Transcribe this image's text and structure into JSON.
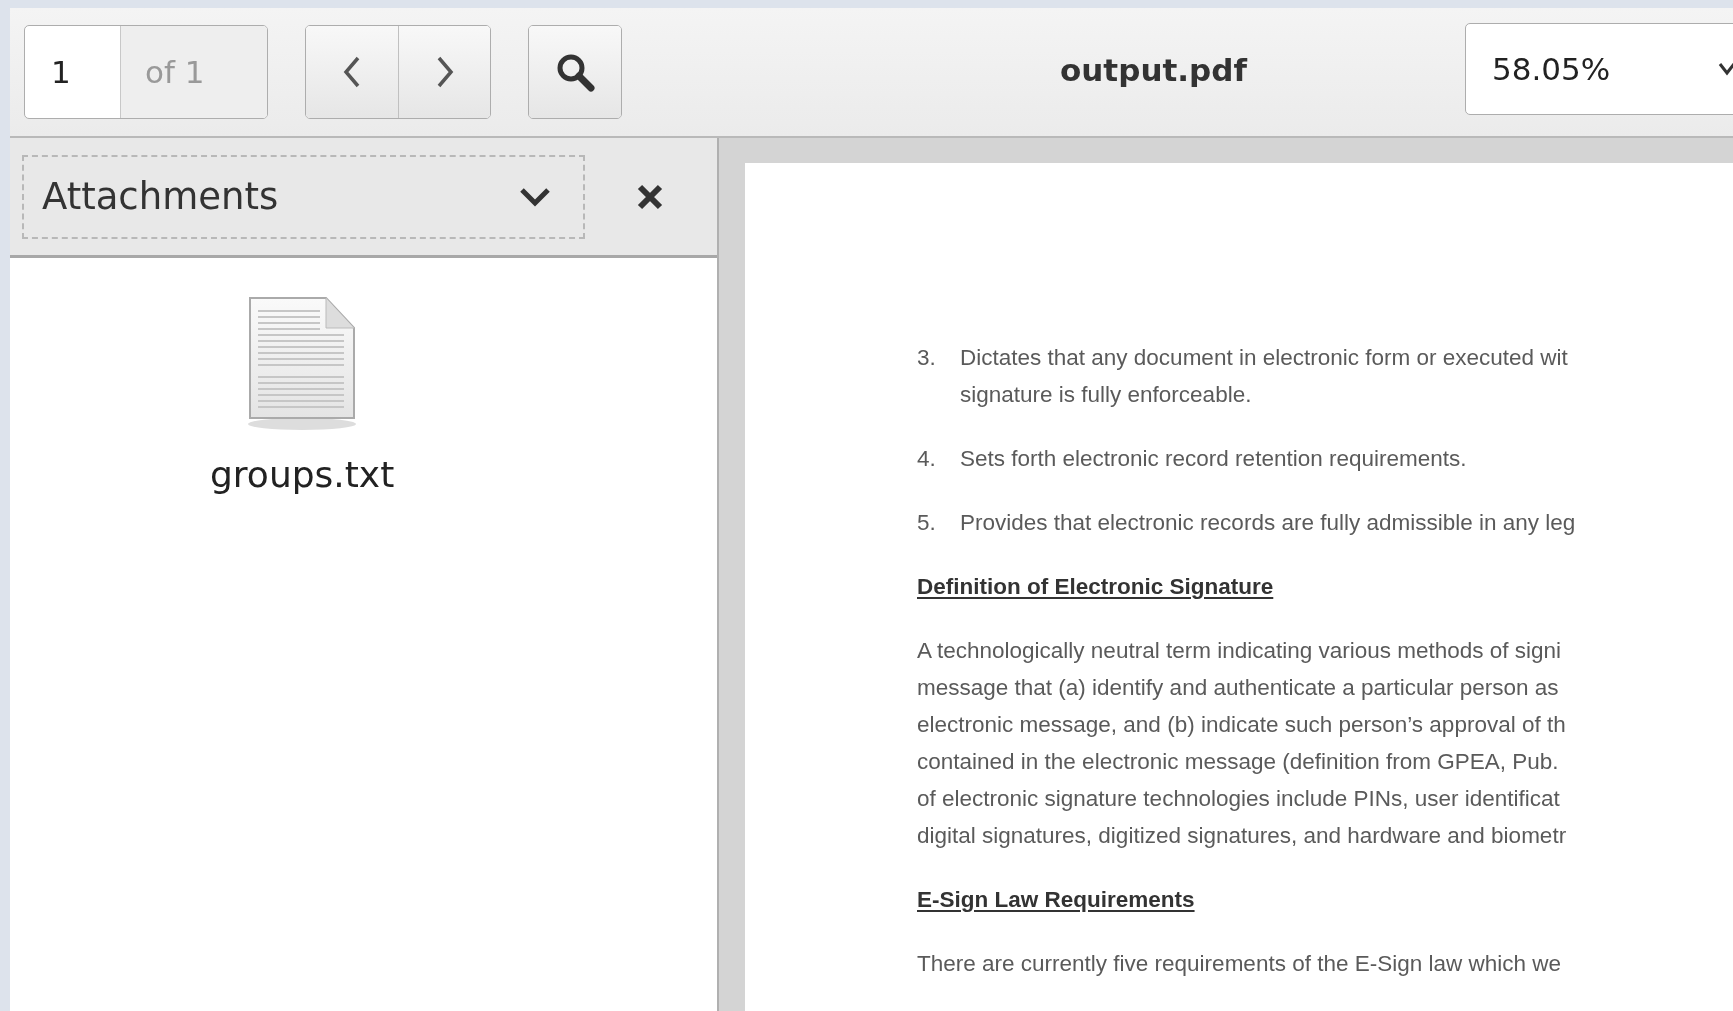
{
  "toolbar": {
    "page_number": "1",
    "page_count": "of 1",
    "title": "output.pdf",
    "zoom": "58.05%"
  },
  "sidebar": {
    "view": "Attachments",
    "attachments": [
      {
        "name": "groups.txt"
      }
    ]
  },
  "document": {
    "blocks": [
      {
        "kind": "list_item",
        "number": "3.",
        "lines": [
          "Dictates that any document in electronic form or executed wit",
          "signature is fully enforceable."
        ]
      },
      {
        "kind": "list_item",
        "number": "4.",
        "lines": [
          "Sets forth electronic record retention requirements."
        ]
      },
      {
        "kind": "list_item",
        "number": "5.",
        "lines": [
          "Provides that electronic records are fully admissible in any leg"
        ]
      },
      {
        "kind": "heading",
        "lines": [
          "Definition of Electronic Signature"
        ]
      },
      {
        "kind": "paragraph",
        "lines": [
          "A technologically neutral term indicating various methods of signi",
          "message that (a) identify and authenticate a particular person as",
          "electronic message, and (b) indicate such person’s approval of th",
          "contained in the electronic message (definition from GPEA, Pub.",
          "of electronic signature technologies include PINs, user identificat",
          "digital signatures, digitized signatures, and hardware and biometr"
        ]
      },
      {
        "kind": "heading",
        "lines": [
          "E-Sign Law Requirements"
        ]
      },
      {
        "kind": "paragraph",
        "lines": [
          "There are currently five requirements of the E-Sign law which we"
        ]
      }
    ]
  }
}
